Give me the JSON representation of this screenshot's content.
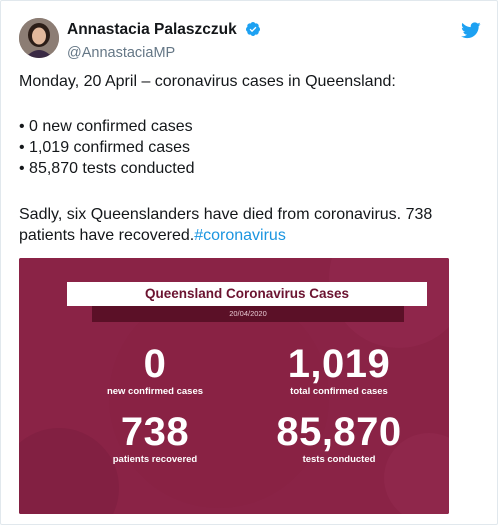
{
  "tweet": {
    "display_name": "Annastacia Palaszczuk",
    "handle": "@AnnastaciaMP",
    "verified_icon": "verified-badge-icon",
    "platform_icon": "twitter-bird-icon",
    "intro": "Monday, 20 April – coronavirus cases in Queensland:",
    "bullets": [
      "• 0 new confirmed cases",
      "• 1,019 confirmed cases",
      "• 85,870 tests conducted"
    ],
    "body": "Sadly, six Queenslanders have died from coronavirus. 738 patients have recovered.",
    "hashtag": "#coronavirus"
  },
  "infographic": {
    "title": "Queensland Coronavirus Cases",
    "date": "20/04/2020",
    "stats": [
      {
        "value": "0",
        "label": "new confirmed cases"
      },
      {
        "value": "1,019",
        "label": "total confirmed cases"
      },
      {
        "value": "738",
        "label": "patients recovered"
      },
      {
        "value": "85,870",
        "label": "tests conducted"
      }
    ]
  },
  "colors": {
    "link": "#1b95e0",
    "infographic_bg": "#8a2346",
    "date_band": "#5b1027"
  }
}
